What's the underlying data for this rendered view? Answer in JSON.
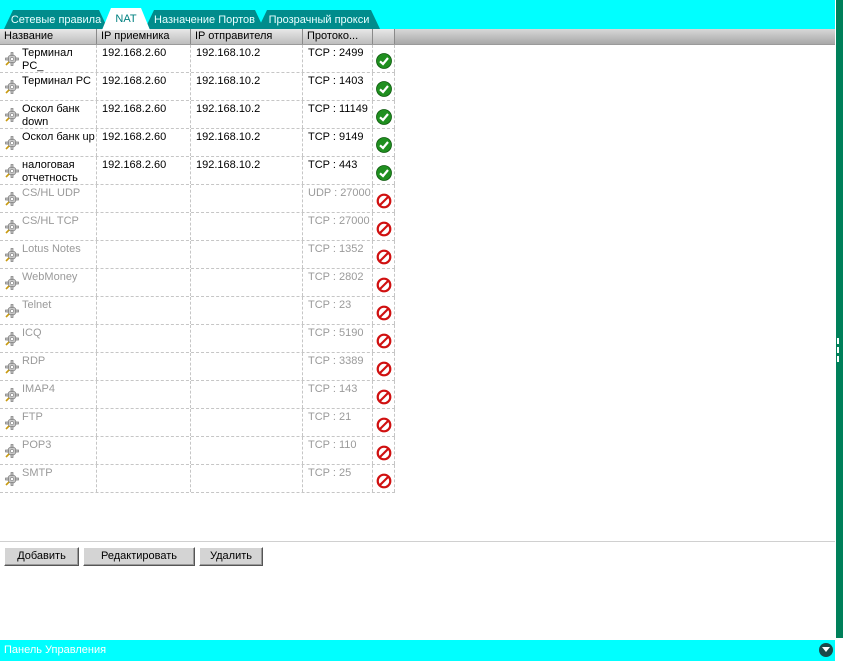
{
  "tabs": [
    {
      "label": "Сетевые правила",
      "active": false
    },
    {
      "label": "NAT",
      "active": true
    },
    {
      "label": "Назначение Портов",
      "active": false
    },
    {
      "label": "Прозрачный прокси",
      "active": false
    }
  ],
  "columns": {
    "name": "Название",
    "dst_ip": "IP приемника",
    "src_ip": "IP отправителя",
    "protocol": "Протоко...",
    "state": ""
  },
  "rows": [
    {
      "name": "Терминал PC_",
      "dst_ip": "192.168.2.60",
      "src_ip": "192.168.10.2",
      "protocol": "TCP : 2499",
      "enabled": true
    },
    {
      "name": "Терминал PC",
      "dst_ip": "192.168.2.60",
      "src_ip": "192.168.10.2",
      "protocol": "TCP : 1403",
      "enabled": true
    },
    {
      "name": "Оскол банк down",
      "dst_ip": "192.168.2.60",
      "src_ip": "192.168.10.2",
      "protocol": "TCP : 11149",
      "enabled": true
    },
    {
      "name": "Оскол банк up",
      "dst_ip": "192.168.2.60",
      "src_ip": "192.168.10.2",
      "protocol": "TCP : 9149",
      "enabled": true
    },
    {
      "name": "налоговая отчетность",
      "dst_ip": "192.168.2.60",
      "src_ip": "192.168.10.2",
      "protocol": "TCP : 443",
      "enabled": true
    },
    {
      "name": "CS/HL UDP",
      "dst_ip": "",
      "src_ip": "",
      "protocol": "UDP : 27000",
      "enabled": false
    },
    {
      "name": "CS/HL TCP",
      "dst_ip": "",
      "src_ip": "",
      "protocol": "TCP : 27000",
      "enabled": false
    },
    {
      "name": "Lotus Notes",
      "dst_ip": "",
      "src_ip": "",
      "protocol": "TCP : 1352",
      "enabled": false
    },
    {
      "name": "WebMoney",
      "dst_ip": "",
      "src_ip": "",
      "protocol": "TCP : 2802",
      "enabled": false
    },
    {
      "name": "Telnet",
      "dst_ip": "",
      "src_ip": "",
      "protocol": "TCP : 23",
      "enabled": false
    },
    {
      "name": "ICQ",
      "dst_ip": "",
      "src_ip": "",
      "protocol": "TCP : 5190",
      "enabled": false
    },
    {
      "name": "RDP",
      "dst_ip": "",
      "src_ip": "",
      "protocol": "TCP : 3389",
      "enabled": false
    },
    {
      "name": "IMAP4",
      "dst_ip": "",
      "src_ip": "",
      "protocol": "TCP : 143",
      "enabled": false
    },
    {
      "name": "FTP",
      "dst_ip": "",
      "src_ip": "",
      "protocol": "TCP : 21",
      "enabled": false
    },
    {
      "name": "POP3",
      "dst_ip": "",
      "src_ip": "",
      "protocol": "TCP : 110",
      "enabled": false
    },
    {
      "name": "SMTP",
      "dst_ip": "",
      "src_ip": "",
      "protocol": "TCP : 25",
      "enabled": false
    }
  ],
  "buttons": {
    "add": "Добавить",
    "edit": "Редактировать",
    "delete": "Удалить"
  },
  "footer": {
    "label": "Панель Управления"
  },
  "icons": {
    "rule": "gear-icon",
    "enabled": "check-circle-icon",
    "disabled": "no-entry-icon",
    "collapse": "chevron-down-icon"
  },
  "colors": {
    "accent": "#00ffff",
    "tab_bg": "#008c8c",
    "enabled_green": "#1f8f1f",
    "disabled_red": "#d01010"
  }
}
